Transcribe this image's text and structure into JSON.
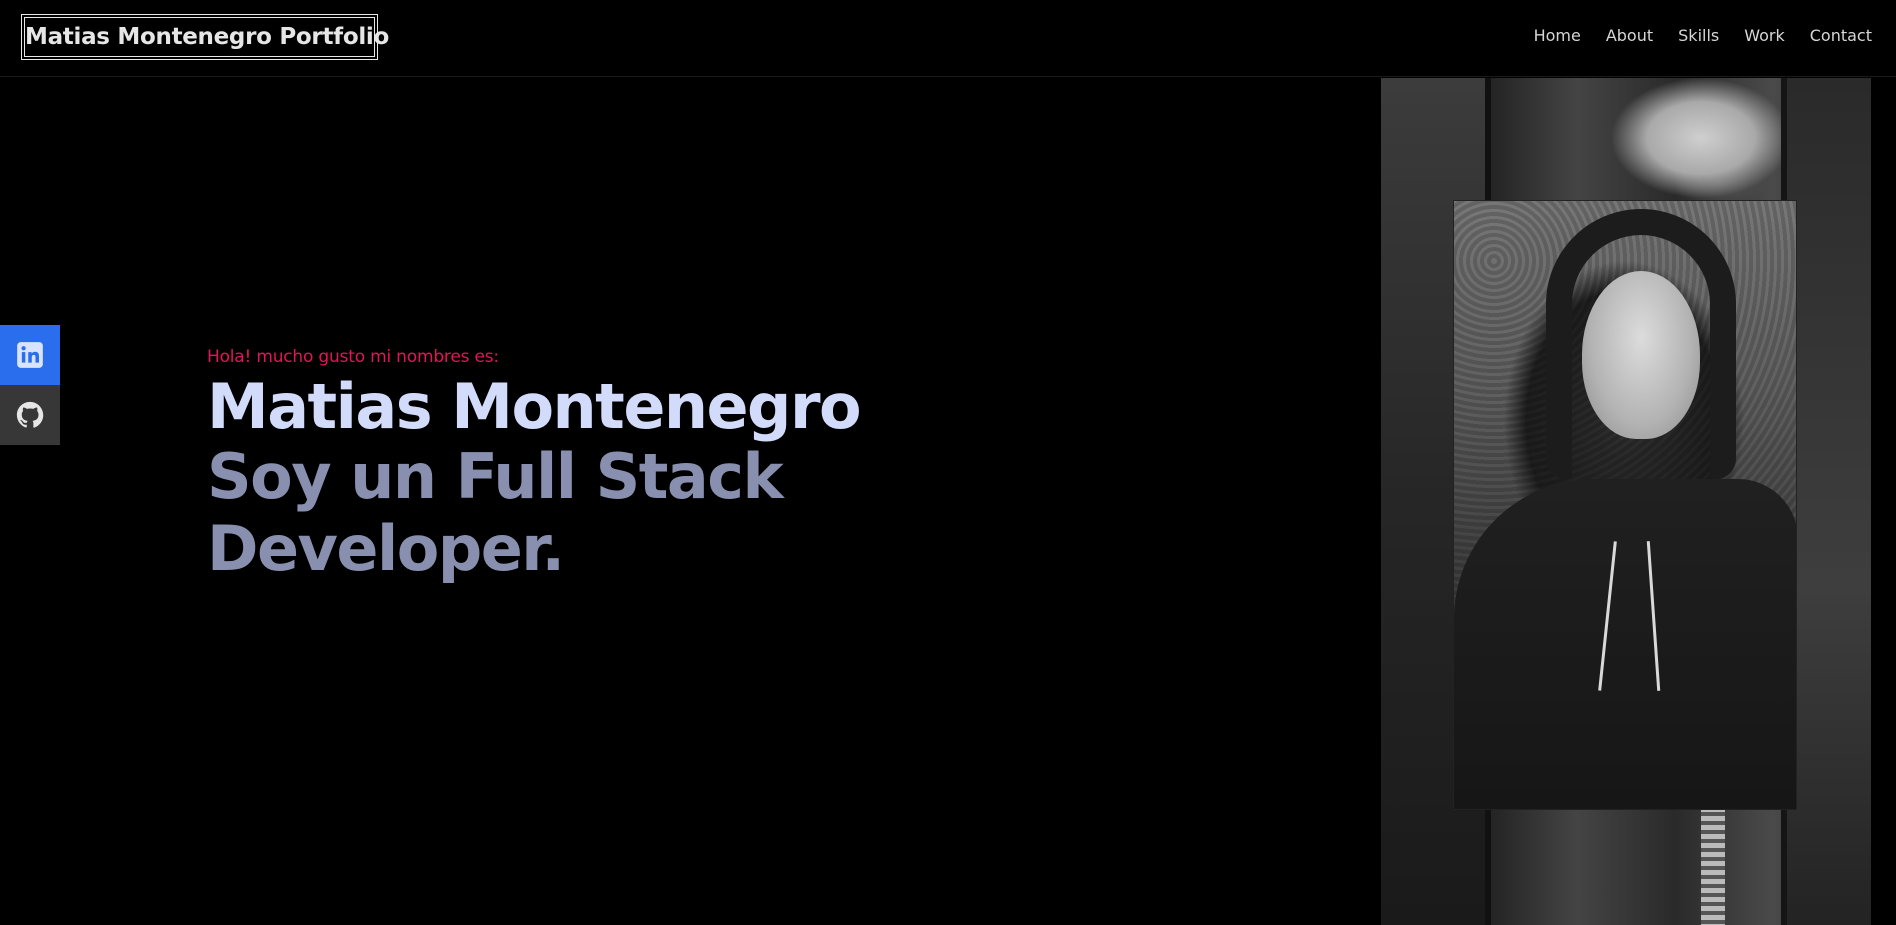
{
  "header": {
    "logo_text": "Matias Montenegro Portfolio",
    "nav": [
      {
        "label": "Home"
      },
      {
        "label": "About"
      },
      {
        "label": "Skills"
      },
      {
        "label": "Work"
      },
      {
        "label": "Contact"
      }
    ]
  },
  "social": [
    {
      "icon": "linkedin-icon",
      "color": "#2a6ded"
    },
    {
      "icon": "github-icon",
      "color": "#373737"
    }
  ],
  "hero": {
    "greeting": "Hola! mucho gusto mi nombres es:",
    "name": "Matias Montenegro",
    "role": "Soy un Full Stack Developer."
  },
  "colors": {
    "background": "#000000",
    "accent": "#e6125a",
    "name_text": "#d3dbfb",
    "role_text": "#8990af"
  }
}
